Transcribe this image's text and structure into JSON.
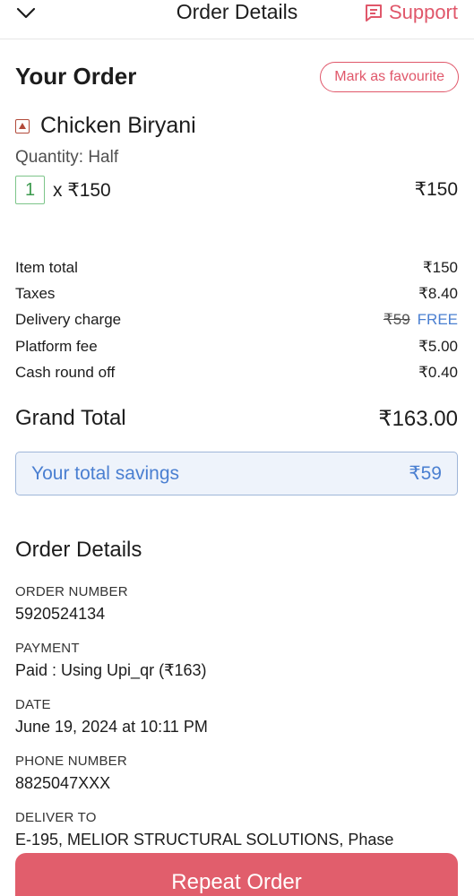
{
  "header": {
    "back_icon": "chevron-down-icon",
    "title": "Order Details",
    "support_label": "Support",
    "support_icon": "chat-icon"
  },
  "order": {
    "title": "Your Order",
    "favourite_label": "Mark as favourite",
    "item": {
      "name": "Chicken Biryani",
      "quantity_text": "Quantity: Half",
      "qty": "1",
      "unit_price": "x ₹150",
      "total": "₹150"
    }
  },
  "bill": {
    "rows": [
      {
        "label": "Item total",
        "value": "₹150"
      },
      {
        "label": "Taxes",
        "value": "₹8.40"
      },
      {
        "label": "Delivery charge",
        "original": "₹59",
        "value": "FREE"
      },
      {
        "label": "Platform fee",
        "value": "₹5.00"
      },
      {
        "label": "Cash round off",
        "value": "₹0.40"
      }
    ],
    "grand_total_label": "Grand Total",
    "grand_total_value": "₹163.00",
    "savings_label": "Your total savings",
    "savings_value": "₹59"
  },
  "order_details": {
    "title": "Order Details",
    "fields": [
      {
        "label": "ORDER NUMBER",
        "value": "5920524134"
      },
      {
        "label": "PAYMENT",
        "value": "Paid : Using Upi_qr (₹163)"
      },
      {
        "label": "DATE",
        "value": "June 19, 2024 at 10:11 PM"
      },
      {
        "label": "PHONE NUMBER",
        "value": "8825047XXX"
      },
      {
        "label": "DELIVER TO",
        "value": "E-195, MELIOR STRUCTURAL SOLUTIONS, Phase"
      }
    ]
  },
  "footer": {
    "repeat_label": "Repeat Order"
  },
  "colors": {
    "accent": "#e0576a",
    "free": "#4a7fd1",
    "veg_box": "#3c9a4e",
    "savings_bg": "#eef3fb"
  }
}
